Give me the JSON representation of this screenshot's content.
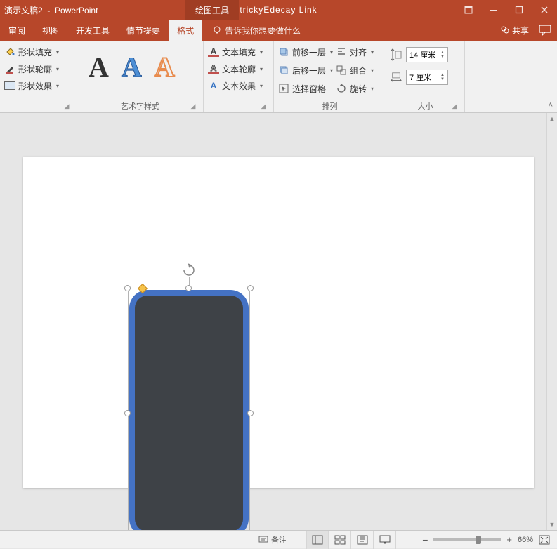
{
  "title_prefix": "演示文稿2",
  "title_app": "PowerPoint",
  "contextual_tab": "绘图工具",
  "brand": "trickyEdecay Link",
  "tabs": {
    "review": "审阅",
    "view": "视图",
    "dev": "开发工具",
    "plot": "情节提要",
    "format": "格式"
  },
  "tellme": "告诉我你想要做什么",
  "share": "共享",
  "ribbon": {
    "shape_fill": "形状填充",
    "shape_outline": "形状轮廓",
    "shape_effects": "形状效果",
    "wordart_label": "艺术字样式",
    "text_fill": "文本填充",
    "text_outline": "文本轮廓",
    "text_effects": "文本效果",
    "bring_forward": "前移一层",
    "send_backward": "后移一层",
    "selection_pane": "选择窗格",
    "align": "对齐",
    "group": "组合",
    "rotate": "旋转",
    "arrange_label": "排列",
    "size_label": "大小",
    "height": "14 厘米",
    "width": "7 厘米"
  },
  "status": {
    "notes": "备注",
    "zoom_pct": "66%"
  },
  "wa_glyph": "A"
}
